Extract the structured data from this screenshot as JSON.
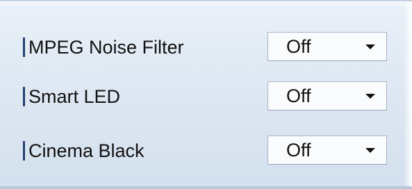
{
  "settings": [
    {
      "label": "MPEG Noise Filter",
      "value": "Off"
    },
    {
      "label": "Smart LED",
      "value": "Off"
    },
    {
      "label": "Cinema Black",
      "value": "Off"
    }
  ],
  "icons": {
    "row_marker": "vertical-bar-icon",
    "dropdown_arrow": "chevron-down-icon"
  },
  "colors": {
    "panel_background": "#dfe8f3",
    "row_marker": "#21416f",
    "dropdown_background": "#fafbfd",
    "dropdown_border": "#a7b6c9"
  }
}
